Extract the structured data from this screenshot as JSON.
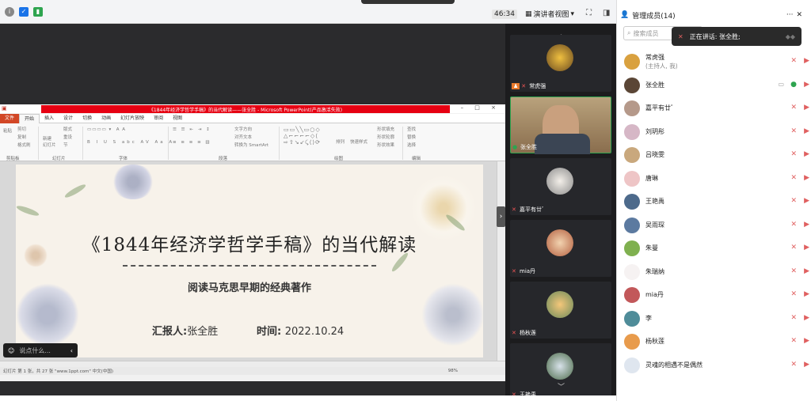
{
  "top": {
    "timer": "46:34",
    "presenter_view": "演讲者视图",
    "notification_bar": ""
  },
  "ppt": {
    "title": "《1844年经济学哲学手稿》的当代解读——张全胜 - Microsoft PowerPoint(产品激活失败)",
    "tabs": [
      "文件",
      "开始",
      "插入",
      "设计",
      "切换",
      "动画",
      "幻灯片放映",
      "审阅",
      "视图"
    ],
    "groups": [
      "剪贴板",
      "幻灯片",
      "字体",
      "段落",
      "绘图",
      "编辑"
    ],
    "ribbon": {
      "paste": "粘贴",
      "cut": "剪切",
      "copy": "复制",
      "format_painter": "格式刷",
      "new_slide": "新建\n幻灯片",
      "layout": "版式",
      "reset": "重设",
      "section": "节",
      "text_direction": "文字方向",
      "align_text": "对齐文本",
      "smartart": "转换为 SmartArt",
      "arrange": "排列",
      "quick_styles": "快速样式",
      "shape_fill": "形状填充",
      "shape_outline": "形状轮廓",
      "shape_effects": "形状效果",
      "find": "查找",
      "replace": "替换",
      "select": "选择"
    },
    "status_left": "幻灯片 第 1 张，共 27 张  \"www.1ppt.com\"  中文(中国)",
    "zoom": "98%"
  },
  "slide": {
    "title": "《1844年经济学哲学手稿》的当代解读",
    "subtitle": "阅读马克思早期的经典著作",
    "reporter_label": "汇报人:",
    "reporter": "张全胜",
    "date_label": "时间:",
    "date": "2022.10.24"
  },
  "chat": {
    "placeholder": "说点什么..."
  },
  "thumbs": [
    {
      "name": "常虎强"
    },
    {
      "name": "张全胜"
    },
    {
      "name": "嘉平有廿゛"
    },
    {
      "name": "mia丹"
    },
    {
      "name": "杨秋莲"
    },
    {
      "name": "王艳禹"
    }
  ],
  "panel": {
    "title": "管理成员(14)",
    "search_placeholder": "搜索成员",
    "speaking": "正在讲话: 张全胜;"
  },
  "members": [
    {
      "name": "常虎强",
      "sub": "(主持人, 我)"
    },
    {
      "name": "张全胜",
      "sub": ""
    },
    {
      "name": "嘉平有廿゛",
      "sub": ""
    },
    {
      "name": "刘玥彤",
      "sub": ""
    },
    {
      "name": "吕晓雯",
      "sub": ""
    },
    {
      "name": "唐琳",
      "sub": ""
    },
    {
      "name": "王艳禹",
      "sub": ""
    },
    {
      "name": "吴雨琛",
      "sub": ""
    },
    {
      "name": "朱曼",
      "sub": ""
    },
    {
      "name": "朱瑞纳",
      "sub": ""
    },
    {
      "name": "mia丹",
      "sub": ""
    },
    {
      "name": "李",
      "sub": ""
    },
    {
      "name": "杨秋莲",
      "sub": ""
    },
    {
      "name": "灵魂的相遇不是偶然",
      "sub": ""
    }
  ],
  "colors": {
    "accent_green": "#2ea44f",
    "mute_red": "#e06060",
    "ppt_red": "#e60012"
  }
}
